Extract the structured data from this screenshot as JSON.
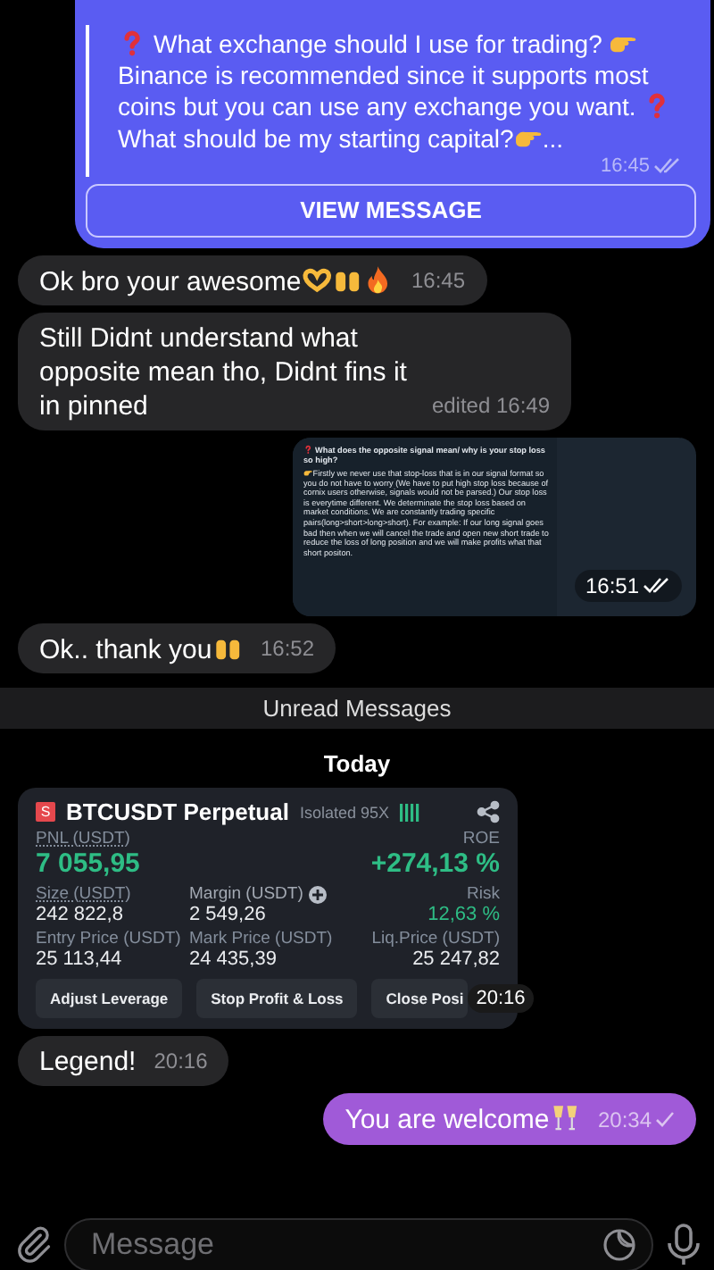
{
  "messages": [
    {
      "kind": "forward",
      "outgoing": true,
      "parts": [
        {
          "kind": "question"
        },
        {
          "kind": "text",
          "text": " What exchange should I use for trading? "
        },
        {
          "kind": "point"
        },
        {
          "kind": "text",
          "text": "Binance is recommended since it supports most coins but you can use any exchange you want.  "
        },
        {
          "kind": "question"
        },
        {
          "kind": "text",
          "text": " What should be my starting capital?"
        },
        {
          "kind": "point"
        },
        {
          "kind": "text",
          "text": "..."
        }
      ],
      "time": "16:45",
      "read": true,
      "button": "VIEW MESSAGE"
    },
    {
      "kind": "text",
      "outgoing": false,
      "parts": [
        {
          "kind": "text",
          "text": "Ok bro your awesome"
        },
        {
          "kind": "heart"
        },
        {
          "kind": "hands"
        },
        {
          "kind": "fire"
        }
      ],
      "time": "16:45"
    },
    {
      "kind": "text",
      "outgoing": false,
      "parts": [
        {
          "kind": "text",
          "text": "Still Didnt understand what opposite mean tho, Didnt fins it in pinned"
        }
      ],
      "time": "edited 16:49"
    },
    {
      "kind": "image",
      "outgoing": true,
      "title": [
        {
          "kind": "question"
        },
        {
          "kind": "text",
          "text": " What does the opposite signal mean/ why is your stop loss so high?"
        }
      ],
      "body": [
        {
          "kind": "point"
        },
        {
          "kind": "text",
          "text": "Firstly we never use that stop-loss that is in our signal format so you do not have to worry (We have to put high stop loss because of cornix users otherwise, signals would not be parsed.) Our stop loss is everytime different.  We determinate the stop loss based on market conditions. We are constantly trading specific pairs(long>short>long>short).  For example: If our long signal goes bad then when we will cancel the trade and open new short trade to reduce the loss of long position and we will make profits what that short positon."
        }
      ],
      "time": "16:51",
      "read": true
    },
    {
      "kind": "text",
      "outgoing": false,
      "parts": [
        {
          "kind": "text",
          "text": "Ok.. thank you"
        },
        {
          "kind": "hands"
        }
      ],
      "time": "16:52"
    },
    {
      "kind": "unread",
      "text": "Unread Messages"
    },
    {
      "kind": "date",
      "text": "Today"
    },
    {
      "kind": "card",
      "outgoing": false,
      "logo": "S",
      "title": "BTCUSDT Perpetual",
      "mode": "Isolated 95X",
      "pnl_label": "PNL (USDT)",
      "pnl": "7 055,95",
      "roe_label": "ROE",
      "roe": "+274,13 %",
      "stats": [
        {
          "label": "Size (USDT)",
          "value": "242 822,8",
          "underline": true,
          "plus": false,
          "accent": false
        },
        {
          "label": "Margin (USDT)",
          "value": "2 549,26",
          "underline": false,
          "plus": true,
          "accent": false
        },
        {
          "label": "Risk",
          "value": "12,63 %",
          "underline": false,
          "plus": false,
          "accent": true
        },
        {
          "label": "Entry Price (USDT)",
          "value": "25 113,44",
          "underline": false,
          "plus": false,
          "accent": false
        },
        {
          "label": "Mark Price (USDT)",
          "value": "24 435,39",
          "underline": false,
          "plus": false,
          "accent": false
        },
        {
          "label": "Liq.Price (USDT)",
          "value": "25 247,82",
          "underline": false,
          "plus": false,
          "accent": false
        }
      ],
      "buttons": [
        "Adjust Leverage",
        "Stop Profit & Loss",
        "Close Posi"
      ],
      "time": "20:16"
    },
    {
      "kind": "text",
      "outgoing": false,
      "parts": [
        {
          "kind": "text",
          "text": "Legend!"
        }
      ],
      "time": "20:16"
    },
    {
      "kind": "text",
      "outgoing": true,
      "parts": [
        {
          "kind": "text",
          "text": "You are welcome"
        },
        {
          "kind": "glasses"
        }
      ],
      "time": "20:34",
      "read": false
    }
  ],
  "composer": {
    "placeholder": "Message"
  }
}
